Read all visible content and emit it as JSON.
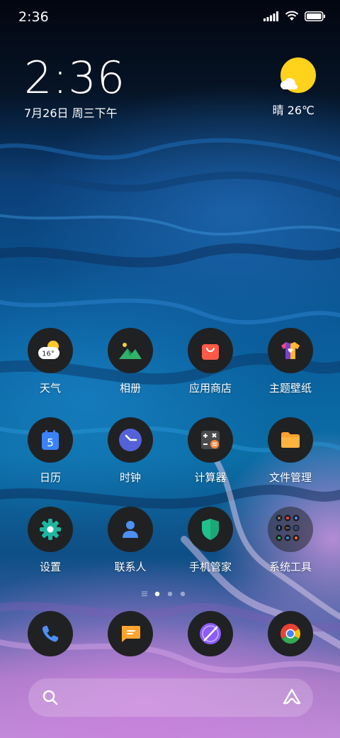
{
  "status_bar": {
    "time": "2:36",
    "icons": [
      "signal-icon",
      "wifi-icon",
      "battery-icon"
    ]
  },
  "clock_widget": {
    "time": "2:36",
    "date": "7月26日 周三下午"
  },
  "weather_widget": {
    "condition": "晴",
    "temperature": "26℃",
    "icon": "sun-cloud-icon",
    "summary": "晴 26℃"
  },
  "apps": [
    {
      "label": "天气",
      "icon": "weather-icon",
      "badge": "16°"
    },
    {
      "label": "相册",
      "icon": "gallery-icon"
    },
    {
      "label": "应用商店",
      "icon": "app-store-icon"
    },
    {
      "label": "主题壁纸",
      "icon": "themes-icon"
    },
    {
      "label": "日历",
      "icon": "calendar-icon",
      "badge": "5"
    },
    {
      "label": "时钟",
      "icon": "clock-icon"
    },
    {
      "label": "计算器",
      "icon": "calculator-icon"
    },
    {
      "label": "文件管理",
      "icon": "file-manager-icon"
    },
    {
      "label": "设置",
      "icon": "settings-icon"
    },
    {
      "label": "联系人",
      "icon": "contacts-icon"
    },
    {
      "label": "手机管家",
      "icon": "security-icon"
    },
    {
      "label": "系统工具",
      "icon": "folder-icon"
    }
  ],
  "page_indicator": {
    "pages": 3,
    "current": 1
  },
  "dock": [
    {
      "icon": "phone-icon"
    },
    {
      "icon": "messages-icon"
    },
    {
      "icon": "browser-icon"
    },
    {
      "icon": "chrome-icon"
    }
  ],
  "search_bar": {
    "icons": [
      "search-icon",
      "assistant-icon"
    ]
  },
  "colors": {
    "icon_bg": "#202122",
    "sun": "#ffd21c",
    "accent_blue": "#3d8ef5"
  }
}
